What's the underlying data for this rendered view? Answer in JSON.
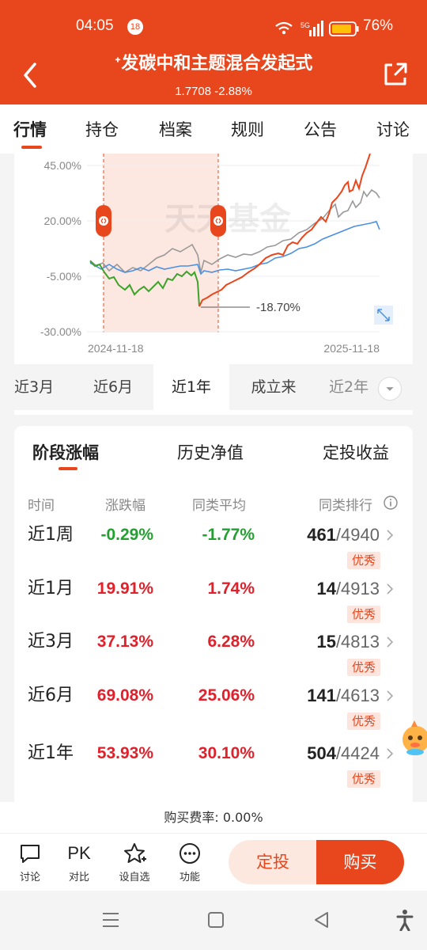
{
  "status_bar": {
    "time": "04:05",
    "notification_count": "18",
    "battery": "76%"
  },
  "header": {
    "title": "ᐩ发碳中和主题混合发起式",
    "nav": "1.7708 -2.88%"
  },
  "tabs": [
    "行情",
    "持仓",
    "档案",
    "规则",
    "公告",
    "讨论"
  ],
  "active_tab": 0,
  "chart": {
    "watermark": "天天基金",
    "y_ticks": [
      "45.00%",
      "20.00%",
      "-5.00%",
      "-30.00%"
    ],
    "x_start": "2024-11-18",
    "x_end": "2025-11-18",
    "min_label": "-18.70%",
    "colors": {
      "fund_up": "#e8471e",
      "fund_down": "#3fa22a",
      "category_avg": "#4a90e2",
      "benchmark": "#999999"
    }
  },
  "range_tabs": [
    "近3月",
    "近6月",
    "近1年",
    "成立来",
    "近2年"
  ],
  "active_range": 2,
  "perf": {
    "tabs": [
      "阶段涨幅",
      "历史净值",
      "定投收益"
    ],
    "columns": {
      "period": "时间",
      "change": "涨跌幅",
      "avg": "同类平均",
      "rank": "同类排行"
    },
    "rows": [
      {
        "period": "近1周",
        "change": "-0.29%",
        "avg": "-1.77%",
        "rank": "461",
        "total": "/4940",
        "badge": "优秀"
      },
      {
        "period": "近1月",
        "change": "19.91%",
        "avg": "1.74%",
        "rank": "14",
        "total": "/4913",
        "badge": "优秀"
      },
      {
        "period": "近3月",
        "change": "37.13%",
        "avg": "6.28%",
        "rank": "15",
        "total": "/4813",
        "badge": "优秀"
      },
      {
        "period": "近6月",
        "change": "69.08%",
        "avg": "25.06%",
        "rank": "141",
        "total": "/4613",
        "badge": "优秀"
      },
      {
        "period": "近1年",
        "change": "53.93%",
        "avg": "30.10%",
        "rank": "504",
        "total": "/4424",
        "badge": "优秀"
      }
    ]
  },
  "fee": "购买费率: 0.00%",
  "bottom_bar": {
    "discuss": "讨论",
    "pk_text": "PK",
    "compare": "对比",
    "watchlist": "设自选",
    "functions": "功能",
    "sip_button": "定投",
    "buy_button": "购买"
  }
}
